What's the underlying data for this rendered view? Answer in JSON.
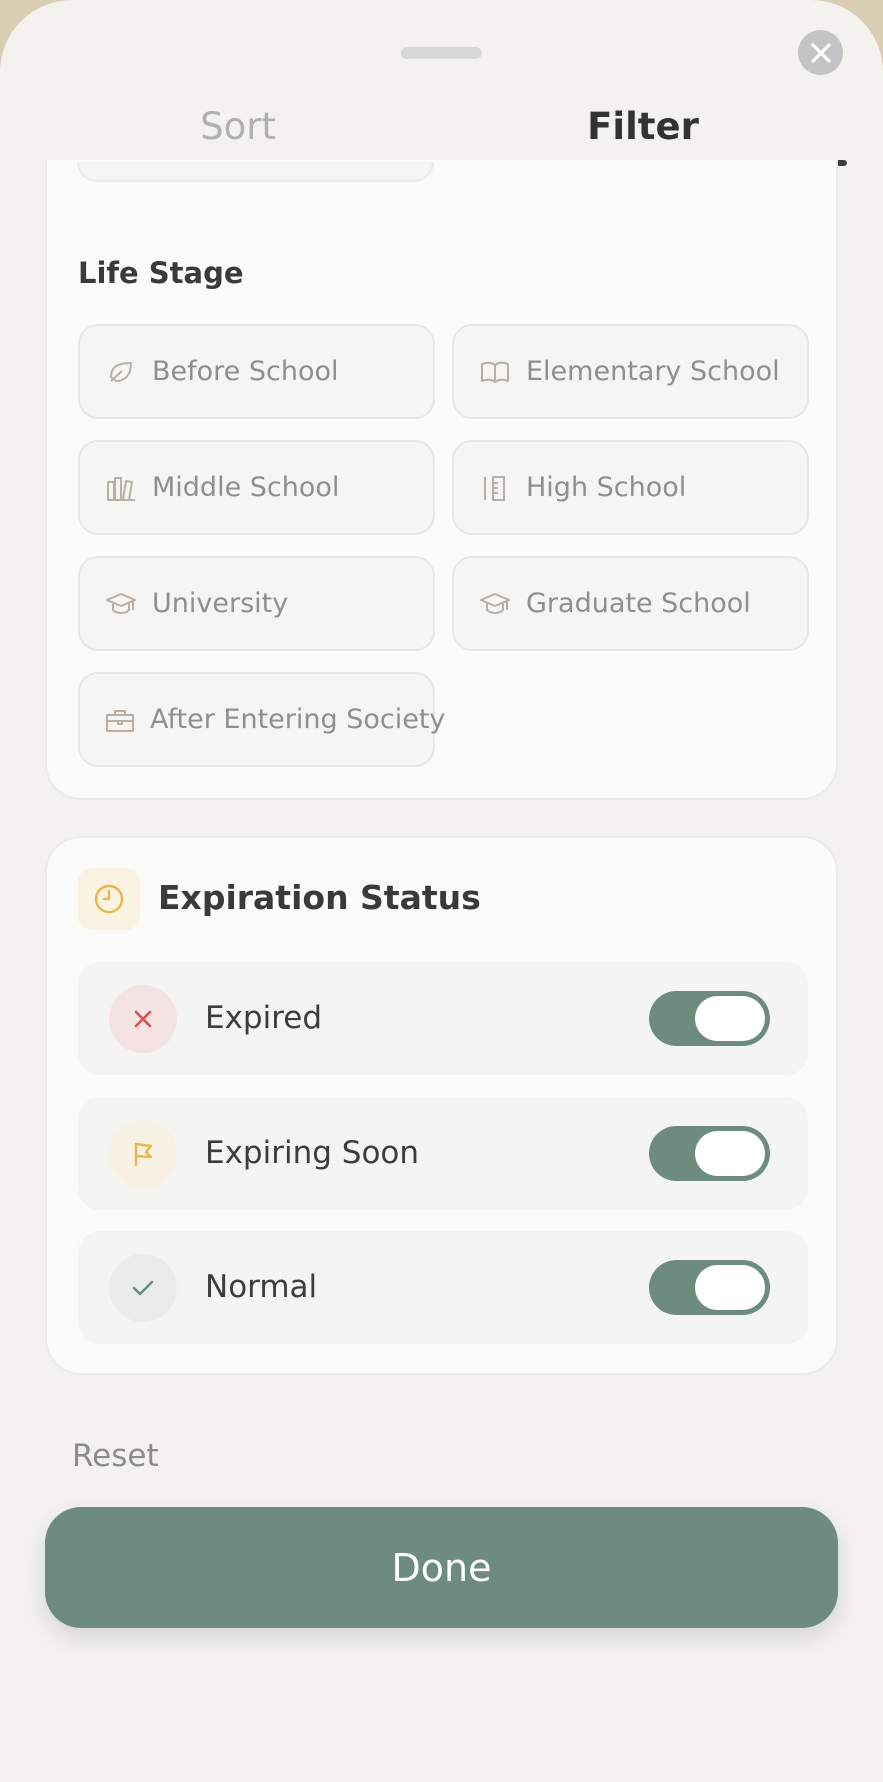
{
  "tabs": {
    "sort": "Sort",
    "filter": "Filter",
    "active": "filter"
  },
  "life_stage": {
    "title": "Life Stage",
    "options": [
      {
        "label": "Before School",
        "icon": "leaf-icon"
      },
      {
        "label": "Elementary School",
        "icon": "book-icon"
      },
      {
        "label": "Middle School",
        "icon": "books-icon"
      },
      {
        "label": "High School",
        "icon": "ruler-icon"
      },
      {
        "label": "University",
        "icon": "graduation-cap-icon"
      },
      {
        "label": "Graduate School",
        "icon": "graduation-cap-icon"
      },
      {
        "label": "After Entering Society",
        "icon": "briefcase-icon"
      }
    ]
  },
  "expiration": {
    "title": "Expiration Status",
    "icon": "clock-icon",
    "items": [
      {
        "label": "Expired",
        "icon": "x-icon",
        "enabled": true
      },
      {
        "label": "Expiring Soon",
        "icon": "flag-icon",
        "enabled": true
      },
      {
        "label": "Normal",
        "icon": "check-icon",
        "enabled": true
      }
    ]
  },
  "footer": {
    "reset": "Reset",
    "done": "Done"
  },
  "colors": {
    "accent": "#6e8c7e",
    "expired": "#d9534f",
    "expiring": "#e6b84a",
    "normal": "#6e8c7e"
  }
}
